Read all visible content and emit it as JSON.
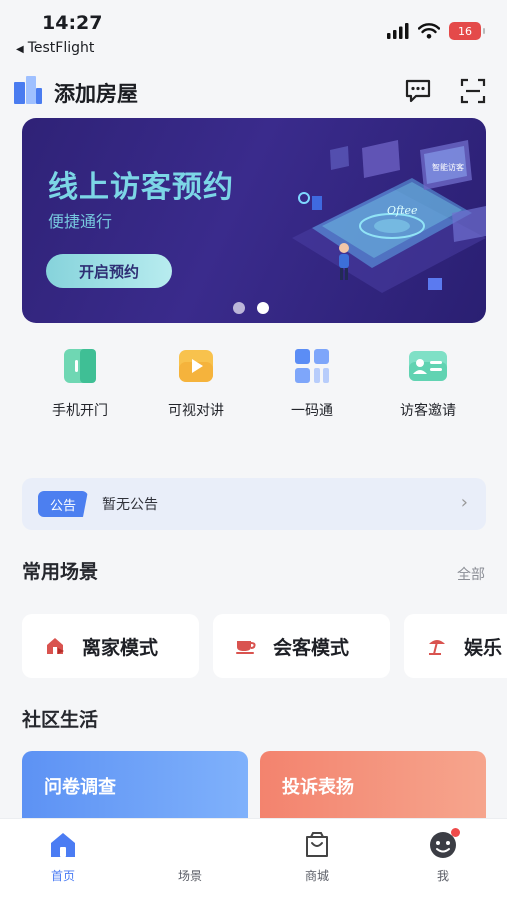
{
  "status_bar": {
    "time": "14:27",
    "back_label": "TestFlight",
    "battery": "16"
  },
  "header": {
    "title": "添加房屋"
  },
  "banner": {
    "title": "线上访客预约",
    "subtitle": "便捷通行",
    "button": "开启预约",
    "art_text_1": "Oftee",
    "art_text_2": "智能访客",
    "slides": 2,
    "active_slide": 2
  },
  "quick_actions": [
    {
      "label": "手机开门",
      "icon": "door-icon"
    },
    {
      "label": "可视对讲",
      "icon": "video-play-icon"
    },
    {
      "label": "一码通",
      "icon": "grid-code-icon"
    },
    {
      "label": "访客邀请",
      "icon": "visitor-card-icon"
    }
  ],
  "notice": {
    "tag": "公告",
    "text": "暂无公告"
  },
  "scenes": {
    "title": "常用场景",
    "more": "全部",
    "items": [
      {
        "label": "离家模式",
        "icon": "leave-home-icon"
      },
      {
        "label": "会客模式",
        "icon": "tea-cup-icon"
      },
      {
        "label": "娱乐",
        "icon": "beach-umbrella-icon"
      }
    ]
  },
  "community": {
    "title": "社区生活",
    "cards": [
      {
        "title": "问卷调查"
      },
      {
        "title": "投诉表扬"
      }
    ]
  },
  "tabbar": {
    "active": "首页",
    "items": [
      {
        "label": "首页",
        "icon": "home-icon"
      },
      {
        "label": "场景",
        "icon": "scene-icon"
      },
      {
        "label": "商城",
        "icon": "shopping-bag-icon"
      },
      {
        "label": "我",
        "icon": "profile-face-icon"
      }
    ]
  },
  "colors": {
    "primary": "#4b7cf3",
    "banner_bg": "#2f2277",
    "accent_red": "#e44a4a"
  }
}
